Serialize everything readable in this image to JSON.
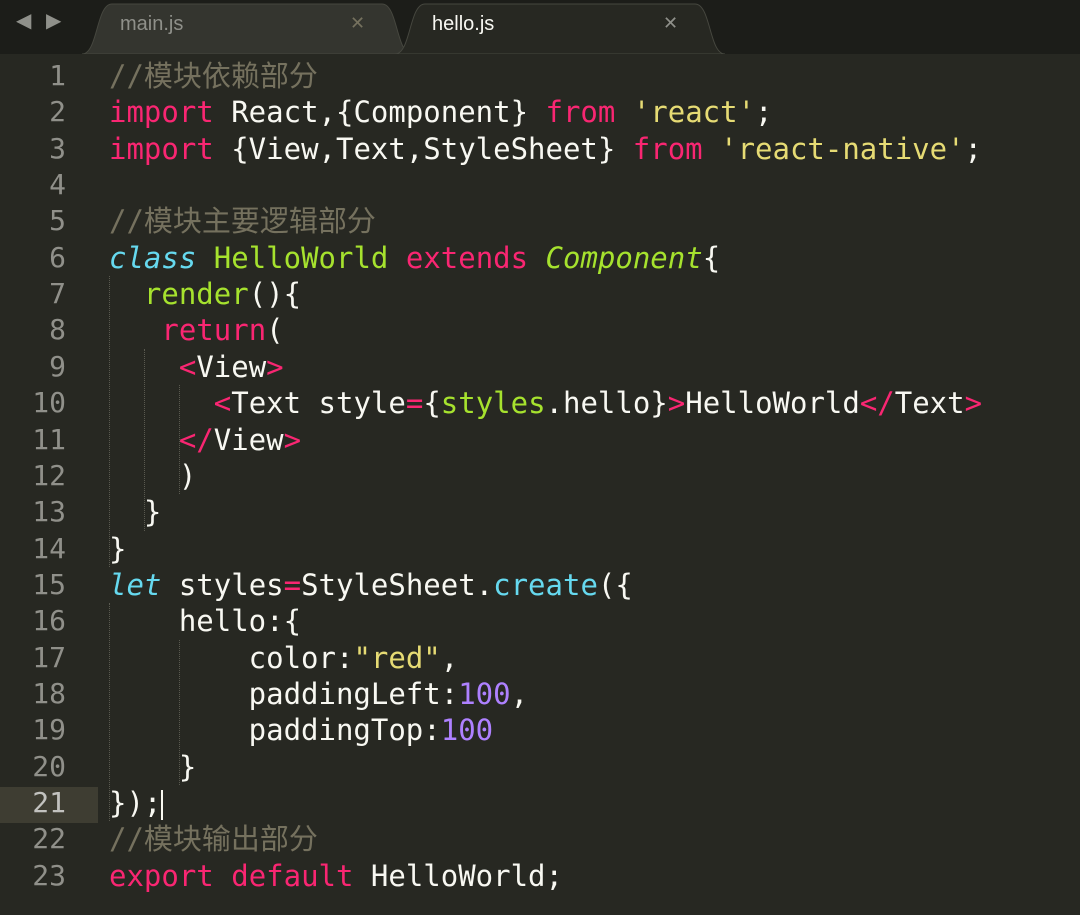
{
  "nav": {
    "back_icon": "◀",
    "forward_icon": "▶"
  },
  "tabs": [
    {
      "label": "main.js",
      "close_icon": "✕",
      "active": false
    },
    {
      "label": "hello.js",
      "close_icon": "✕",
      "active": true
    }
  ],
  "editor": {
    "current_line": 21,
    "line_numbers": [
      "1",
      "2",
      "3",
      "4",
      "5",
      "6",
      "7",
      "8",
      "9",
      "10",
      "11",
      "12",
      "13",
      "14",
      "15",
      "16",
      "17",
      "18",
      "19",
      "20",
      "21",
      "22",
      "23"
    ],
    "lines": [
      [
        {
          "t": "//模块依赖部分",
          "c": "cm"
        }
      ],
      [
        {
          "t": "import",
          "c": "kw"
        },
        {
          "t": " React,{Component} "
        },
        {
          "t": "from",
          "c": "kw"
        },
        {
          "t": " "
        },
        {
          "t": "'react'",
          "c": "st"
        },
        {
          "t": ";"
        }
      ],
      [
        {
          "t": "import",
          "c": "kw"
        },
        {
          "t": " {View,Text,StyleSheet} "
        },
        {
          "t": "from",
          "c": "kw"
        },
        {
          "t": " "
        },
        {
          "t": "'react-native'",
          "c": "st"
        },
        {
          "t": ";"
        }
      ],
      [],
      [
        {
          "t": "//模块主要逻辑部分",
          "c": "cm"
        }
      ],
      [
        {
          "t": "class",
          "c": "cl"
        },
        {
          "t": " "
        },
        {
          "t": "HelloWorld",
          "c": "en"
        },
        {
          "t": " "
        },
        {
          "t": "extends",
          "c": "kw"
        },
        {
          "t": " "
        },
        {
          "t": "Component",
          "c": "inh"
        },
        {
          "t": "{"
        }
      ],
      [
        {
          "t": "  "
        },
        {
          "t": "render",
          "c": "en"
        },
        {
          "t": "(){"
        }
      ],
      [
        {
          "t": "   "
        },
        {
          "t": "return",
          "c": "kw"
        },
        {
          "t": "("
        }
      ],
      [
        {
          "t": "    "
        },
        {
          "t": "<",
          "c": "kw"
        },
        {
          "t": "View"
        },
        {
          "t": ">",
          "c": "kw"
        }
      ],
      [
        {
          "t": "      "
        },
        {
          "t": "<",
          "c": "kw"
        },
        {
          "t": "Text style"
        },
        {
          "t": "=",
          "c": "kw"
        },
        {
          "t": "{"
        },
        {
          "t": "styles",
          "c": "en"
        },
        {
          "t": ".hello}"
        },
        {
          "t": ">",
          "c": "kw"
        },
        {
          "t": "HelloWorld"
        },
        {
          "t": "</",
          "c": "kw"
        },
        {
          "t": "Text"
        },
        {
          "t": ">",
          "c": "kw"
        }
      ],
      [
        {
          "t": "    "
        },
        {
          "t": "</",
          "c": "kw"
        },
        {
          "t": "View"
        },
        {
          "t": ">",
          "c": "kw"
        }
      ],
      [
        {
          "t": "    )"
        }
      ],
      [
        {
          "t": "  }"
        }
      ],
      [
        {
          "t": "}"
        }
      ],
      [
        {
          "t": "let",
          "c": "cl"
        },
        {
          "t": " styles"
        },
        {
          "t": "=",
          "c": "kw"
        },
        {
          "t": "StyleSheet."
        },
        {
          "t": "create",
          "c": "fn"
        },
        {
          "t": "({"
        }
      ],
      [
        {
          "t": "    hello:{"
        }
      ],
      [
        {
          "t": "        color:"
        },
        {
          "t": "\"red\"",
          "c": "st"
        },
        {
          "t": ","
        }
      ],
      [
        {
          "t": "        paddingLeft:"
        },
        {
          "t": "100",
          "c": "num"
        },
        {
          "t": ","
        }
      ],
      [
        {
          "t": "        paddingTop:"
        },
        {
          "t": "100",
          "c": "num"
        }
      ],
      [
        {
          "t": "    }"
        }
      ],
      [
        {
          "t": "});"
        }
      ],
      [
        {
          "t": "//模块输出部分",
          "c": "cm"
        }
      ],
      [
        {
          "t": "export",
          "c": "kw"
        },
        {
          "t": " "
        },
        {
          "t": "default",
          "c": "kw"
        },
        {
          "t": " HelloWorld;"
        }
      ]
    ]
  },
  "colors": {
    "background": "#272822",
    "keyword": "#f92672",
    "string": "#e6db74",
    "comment": "#75715e",
    "entity": "#a6e22e",
    "storage": "#66d9ef",
    "number": "#ae81ff"
  }
}
